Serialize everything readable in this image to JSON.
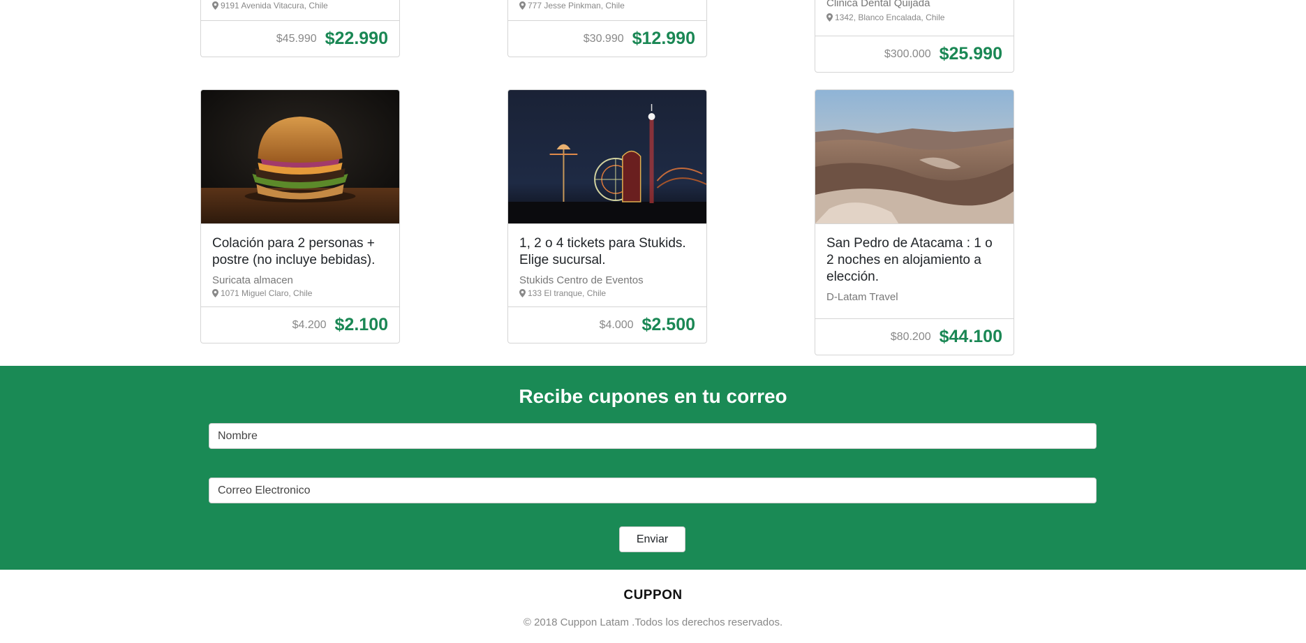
{
  "top_cards": [
    {
      "address": "9191 Avenida Vitacura, Chile",
      "price_old": "$45.990",
      "price_new": "$22.990"
    },
    {
      "address": "777 Jesse Pinkman, Chile",
      "price_old": "$30.990",
      "price_new": "$12.990"
    },
    {
      "merchant": "Clinica Dental Quijada",
      "address": "1342, Blanco Encalada, Chile",
      "price_old": "$300.000",
      "price_new": "$25.990"
    }
  ],
  "cards": [
    {
      "image": "burger-photo",
      "title": "Colación para 2 personas + postre (no incluye bebidas).",
      "merchant": "Suricata almacen",
      "address": "1071 Miguel Claro, Chile",
      "price_old": "$4.200",
      "price_new": "$2.100"
    },
    {
      "image": "amusement-park-photo",
      "title": "1, 2 o 4 tickets para Stukids. Elige sucursal.",
      "merchant": "Stukids Centro de Eventos",
      "address": "133 El tranque, Chile",
      "price_old": "$4.000",
      "price_new": "$2.500"
    },
    {
      "image": "desert-valley-photo",
      "title": "San Pedro de Atacama : 1 o 2 noches en alojamiento a elección.",
      "merchant": "D-Latam Travel",
      "price_old": "$80.200",
      "price_new": "$44.100"
    }
  ],
  "newsletter": {
    "heading": "Recibe cupones en tu correo",
    "name_placeholder": "Nombre",
    "email_placeholder": "Correo Electronico",
    "submit_label": "Enviar"
  },
  "footer": {
    "brand": "CUPPON",
    "copyright": "© 2018 Cuppon Latam .Todos los derechos reservados."
  },
  "colors": {
    "brand_green": "#1a8a55",
    "price_green": "#1a8754"
  }
}
